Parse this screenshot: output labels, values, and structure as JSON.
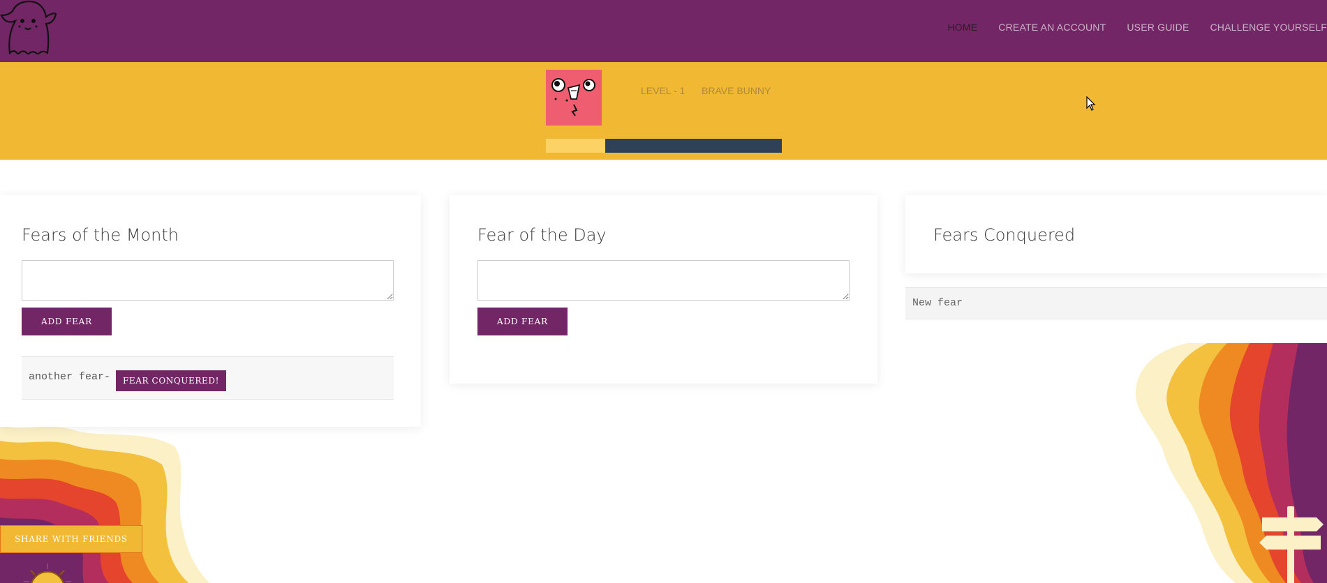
{
  "nav": {
    "links": [
      "HOME",
      "CREATE AN ACCOUNT",
      "USER GUIDE",
      "CHALLENGE YOURSELF"
    ]
  },
  "banner": {
    "level": "LEVEL - 1",
    "badge": "BRAVE BUNNY",
    "progress_fraction": 0.25
  },
  "month_card": {
    "title": "Fears of the Month",
    "input_value": "",
    "add_label": "ADD FEAR",
    "fears": [
      {
        "text": "another fear-",
        "conquer_label": "FEAR CONQUERED!"
      }
    ]
  },
  "day_card": {
    "title": "Fear of the Day",
    "input_value": "",
    "add_label": "ADD FEAR"
  },
  "conquered_card": {
    "title": "Fears Conquered",
    "items": [
      "New fear"
    ]
  },
  "share": {
    "label": "SHARE WITH FRIENDS"
  },
  "colors": {
    "brand_purple": "#732666",
    "brand_yellow": "#f0b833",
    "avatar_pink": "#ef5d70",
    "progress_track": "#2f4157",
    "progress_fill": "#fdd265"
  },
  "icons": [
    "ghost-logo-icon",
    "face-avatar-icon",
    "sun-icon",
    "signpost-icon",
    "cursor-icon"
  ]
}
